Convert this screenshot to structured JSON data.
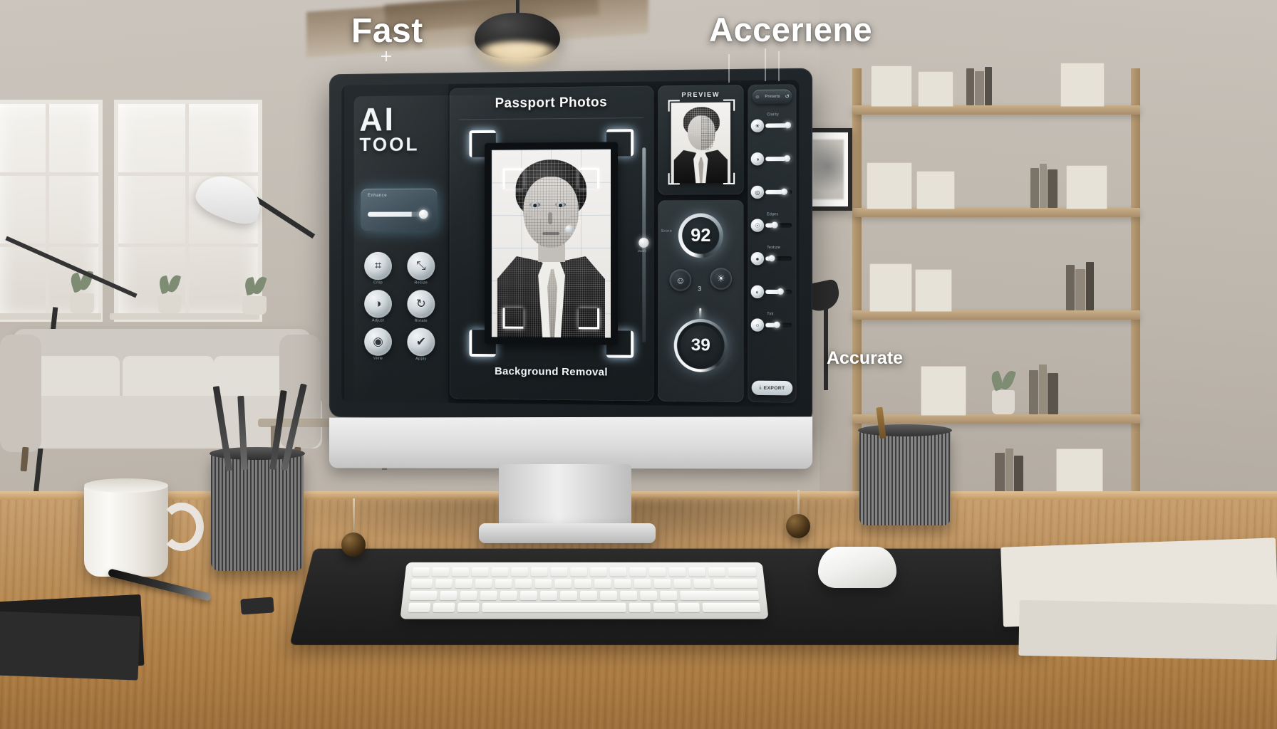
{
  "overlay": {
    "headline_left": "Fast",
    "headline_right": "Accerıene",
    "caption_right": "Accurate"
  },
  "app": {
    "brand_line1": "AI",
    "brand_line2": "TOOL",
    "left_rail": {
      "top_slider": {
        "label": "Enhance",
        "value_percent": 78
      },
      "tools": [
        {
          "icon": "crop-icon",
          "glyph": "⌗",
          "label": "Crop"
        },
        {
          "icon": "resize-icon",
          "glyph": "⤡",
          "label": "Resize"
        },
        {
          "icon": "brightness-icon",
          "glyph": "◑",
          "label": "Adjust"
        },
        {
          "icon": "rotate-icon",
          "glyph": "↻",
          "label": "Rotate"
        },
        {
          "icon": "eye-icon",
          "glyph": "◉",
          "label": "View"
        },
        {
          "icon": "check-icon",
          "glyph": "✔",
          "label": "Apply"
        }
      ]
    },
    "center": {
      "title": "Passport Photos",
      "caption": "Background Removal",
      "vertical_slider": {
        "label": "Zoom",
        "value_percent": 46
      }
    },
    "right": {
      "preview_title": "PREVIEW",
      "score_dial": {
        "label": "Score",
        "value": "92"
      },
      "score_buttons": [
        {
          "icon": "face-detect-icon",
          "glyph": "☺"
        },
        {
          "icon": "lighting-icon",
          "glyph": "☀"
        }
      ],
      "score_sub": "3",
      "second_dial": {
        "value": "39"
      }
    },
    "panel": {
      "segment": {
        "left_icon": "person-icon",
        "left_glyph": "☺",
        "middle_label": "Presets",
        "right_icon": "refresh-icon",
        "right_glyph": "↺"
      },
      "sliders": [
        {
          "icon": "brightness-icon",
          "glyph": "☀",
          "label": "Clarity",
          "value_percent": 82
        },
        {
          "icon": "contrast-icon",
          "glyph": "◑",
          "label": "",
          "value_percent": 78
        },
        {
          "icon": "saturation-icon",
          "glyph": "◎",
          "label": "",
          "value_percent": 68
        },
        {
          "icon": "exposure-icon",
          "glyph": "☉",
          "label": "Edges",
          "value_percent": 30
        },
        {
          "icon": "sharpness-icon",
          "glyph": "●",
          "label": "Texture",
          "value_percent": 18
        },
        {
          "icon": "shadow-icon",
          "glyph": "◐",
          "label": "",
          "value_percent": 52
        },
        {
          "icon": "tint-icon",
          "glyph": "○",
          "label": "Tint",
          "value_percent": 40
        }
      ],
      "export_button": {
        "label": "EXPORT",
        "icon": "download-icon",
        "glyph": "⤓"
      }
    }
  },
  "colors": {
    "screen_bg": "#151a1d",
    "panel_bg": "#262d31",
    "accent_glow": "#bfe1ff",
    "text_primary": "#f4f8fa",
    "text_muted": "#9fb0b8",
    "desk_wood": "#b5874f"
  }
}
